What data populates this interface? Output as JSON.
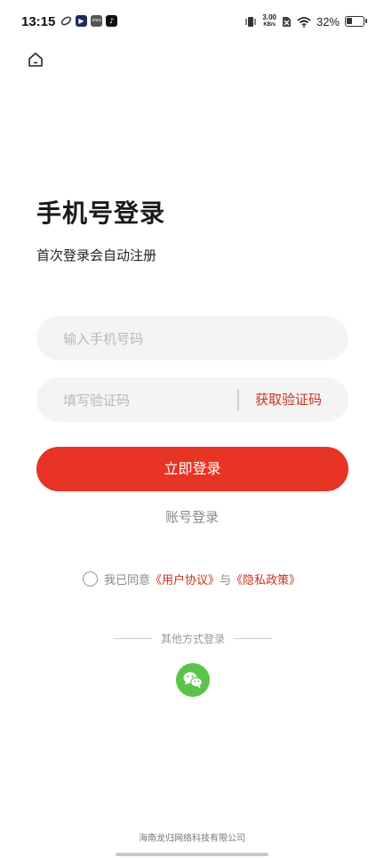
{
  "status_bar": {
    "time": "13:15",
    "net_speed_value": "3.00",
    "net_speed_unit": "KB/s",
    "battery_percent": "32%",
    "battery_level": 0.32,
    "app_icons": [
      "sync-icon",
      "video-icon",
      "vivo-icon",
      "tiktok-icon"
    ]
  },
  "page": {
    "title": "手机号登录",
    "subtitle": "首次登录会自动注册"
  },
  "form": {
    "phone_placeholder": "输入手机号码",
    "code_placeholder": "填写验证码",
    "get_code_label": "获取验证码",
    "submit_label": "立即登录",
    "account_login_label": "账号登录"
  },
  "agreement": {
    "prefix": "我已同意",
    "user_agreement": "《用户协议》",
    "connector": "与",
    "privacy_policy": "《隐私政策》"
  },
  "other_login": {
    "label": "其他方式登录",
    "icons": [
      "wechat-icon"
    ]
  },
  "footer": {
    "company": "海南龙归网络科技有限公司"
  },
  "colors": {
    "accent": "#e73425",
    "link": "#c8321e",
    "wechat": "#5cc34a",
    "field_bg": "#f4f4f4"
  }
}
